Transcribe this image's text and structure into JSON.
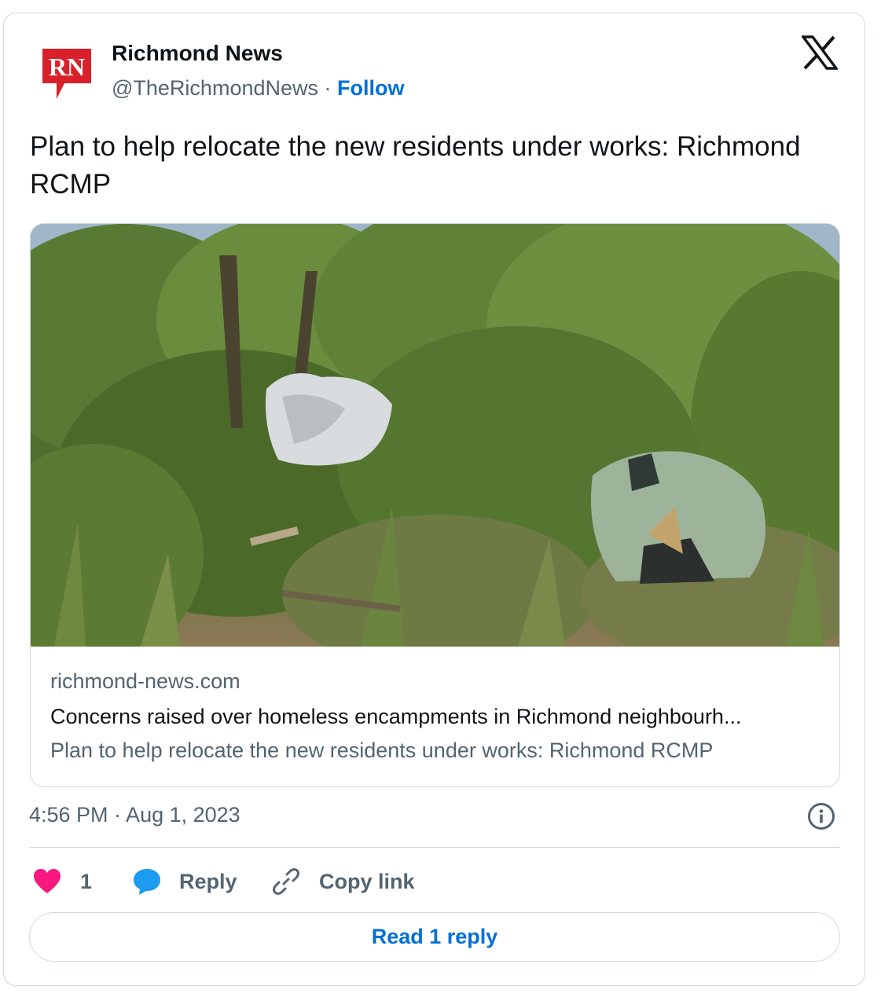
{
  "author": {
    "name": "Richmond News",
    "handle": "@TheRichmondNews",
    "separator": "·",
    "follow_label": "Follow",
    "logo_text": "RN"
  },
  "tweet": {
    "text": "Plan to help relocate the new residents under works: Richmond RCMP"
  },
  "link_card": {
    "domain": "richmond-news.com",
    "title": "Concerns raised over homeless encampments in Richmond neighbourh...",
    "description": "Plan to help relocate the new residents under works: Richmond RCMP"
  },
  "meta": {
    "timestamp": "4:56 PM · Aug 1, 2023"
  },
  "actions": {
    "like_count": "1",
    "reply_label": "Reply",
    "copy_label": "Copy link"
  },
  "read_reply_label": "Read 1 reply",
  "colors": {
    "accent": "#006fd6",
    "like": "#f91880",
    "reply_icon": "#1d9bf0",
    "border": "#cfd9de",
    "secondary_text": "#536471",
    "brand_red": "#d8212a"
  },
  "icons": [
    "rn-logo-icon",
    "x-logo-icon",
    "info-icon",
    "heart-icon",
    "speech-bubble-icon",
    "link-icon"
  ]
}
